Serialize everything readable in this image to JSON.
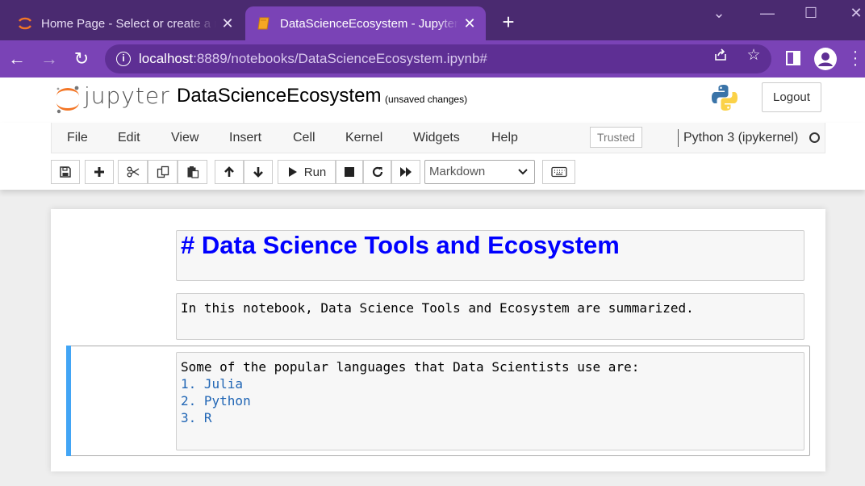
{
  "browser": {
    "tabs": [
      {
        "title": "Home Page - Select or create a notebook",
        "active": false
      },
      {
        "title": "DataScienceEcosystem - Jupyter Notebook",
        "active": true
      }
    ],
    "url_host": "localhost",
    "url_path": ":8889/notebooks/DataScienceEcosystem.ipynb#",
    "colors": {
      "tabstrip": "#4a2a70",
      "active_tab": "#7a43b6",
      "omnibox": "#5e2f94"
    }
  },
  "header": {
    "logo_text": "jupyter",
    "notebook_name": "DataScienceEcosystem",
    "autosave_status": "(unsaved changes)",
    "logout_label": "Logout"
  },
  "menubar": {
    "items": [
      "File",
      "Edit",
      "View",
      "Insert",
      "Cell",
      "Kernel",
      "Widgets",
      "Help"
    ],
    "trusted_label": "Trusted",
    "kernel_name": "Python 3 (ipykernel)"
  },
  "toolbar": {
    "run_label": "Run",
    "cell_type": "Markdown",
    "icons": [
      "save-icon",
      "plus-icon",
      "cut-icon",
      "copy-icon",
      "paste-icon",
      "arrow-up-icon",
      "arrow-down-icon",
      "step-forward-icon",
      "stop-icon",
      "restart-icon",
      "fast-forward-icon",
      "keyboard-icon"
    ]
  },
  "cells": {
    "cell1": {
      "text": "# Data Science Tools and Ecosystem"
    },
    "cell2": {
      "text": "In this notebook, Data Science Tools and Ecosystem are summarized."
    },
    "cell3": {
      "intro": "Some of the popular languages that Data Scientists use are:",
      "items": [
        "1. Julia",
        "2. Python",
        "3. R"
      ]
    },
    "selected_color": "#42a5f5",
    "heading_color": "#0000ff",
    "list_color": "#2166b5"
  }
}
